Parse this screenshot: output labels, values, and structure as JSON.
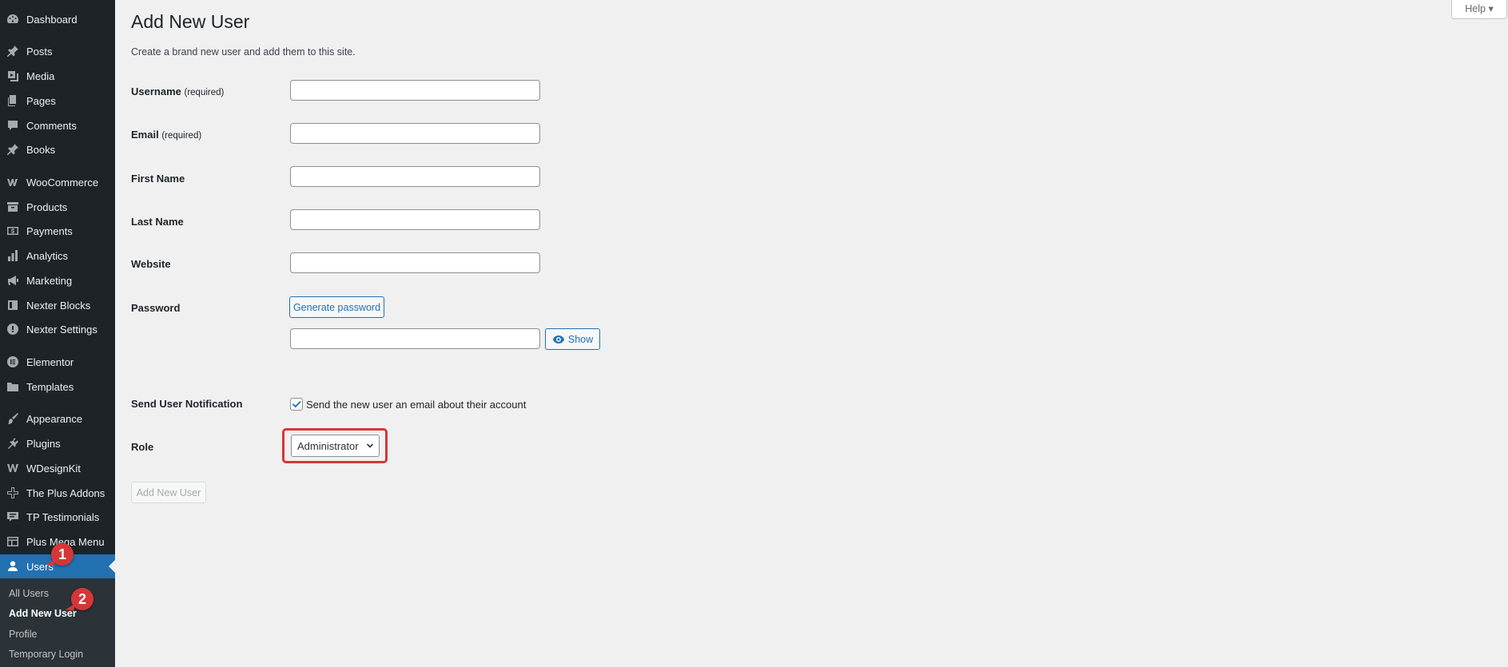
{
  "sidebar": {
    "items": [
      {
        "label": "Dashboard",
        "icon": "dashboard-icon"
      },
      {
        "label": "Posts",
        "icon": "pin-icon"
      },
      {
        "label": "Media",
        "icon": "media-icon"
      },
      {
        "label": "Pages",
        "icon": "pages-icon"
      },
      {
        "label": "Comments",
        "icon": "comment-icon"
      },
      {
        "label": "Books",
        "icon": "pin-icon"
      },
      {
        "label": "WooCommerce",
        "icon": "woo-icon"
      },
      {
        "label": "Products",
        "icon": "archive-icon"
      },
      {
        "label": "Payments",
        "icon": "dollar-icon"
      },
      {
        "label": "Analytics",
        "icon": "bar-chart-icon"
      },
      {
        "label": "Marketing",
        "icon": "megaphone-icon"
      },
      {
        "label": "Nexter Blocks",
        "icon": "block-icon"
      },
      {
        "label": "Nexter Settings",
        "icon": "info-icon"
      },
      {
        "label": "Elementor",
        "icon": "elementor-icon"
      },
      {
        "label": "Templates",
        "icon": "folder-icon"
      },
      {
        "label": "Appearance",
        "icon": "brush-icon"
      },
      {
        "label": "Plugins",
        "icon": "plug-icon"
      },
      {
        "label": "WDesignKit",
        "icon": "w-icon"
      },
      {
        "label": "The Plus Addons",
        "icon": "plus-addons-icon"
      },
      {
        "label": "TP Testimonials",
        "icon": "testimonial-icon"
      },
      {
        "label": "Plus Mega Menu",
        "icon": "menu-grid-icon"
      },
      {
        "label": "Users",
        "icon": "user-icon"
      }
    ],
    "submenu": [
      "All Users",
      "Add New User",
      "Profile",
      "Temporary Login"
    ],
    "badges": [
      "1",
      "2"
    ]
  },
  "page": {
    "title": "Add New User",
    "description": "Create a brand new user and add them to this site.",
    "help": "Help ▾"
  },
  "form": {
    "username_label": "Username",
    "email_label": "Email",
    "required": "(required)",
    "first_name_label": "First Name",
    "last_name_label": "Last Name",
    "website_label": "Website",
    "password_label": "Password",
    "generate_password": "Generate password",
    "show": "Show",
    "notification_label": "Send User Notification",
    "notification_text": "Send the new user an email about their account",
    "role_label": "Role",
    "role_value": "Administrator",
    "submit": "Add New User"
  },
  "colors": {
    "accent": "#2271b1",
    "highlight": "#d63638",
    "sidebar": "#1d2327"
  }
}
